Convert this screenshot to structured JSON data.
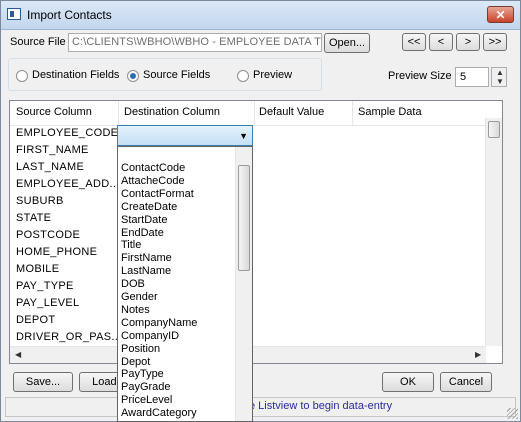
{
  "window": {
    "title": "Import Contacts",
    "close_glyph": "✕"
  },
  "source_file": {
    "label": "Source File",
    "value": "C:\\CLIENTS\\WBHO\\WBHO - EMPLOYEE DATA T",
    "open_label": "Open..."
  },
  "nav_buttons": [
    "<<",
    "<",
    ">",
    ">>"
  ],
  "view_options": {
    "items": [
      {
        "label": "Destination Fields",
        "selected": false
      },
      {
        "label": "Source Fields",
        "selected": true
      },
      {
        "label": "Preview",
        "selected": false
      }
    ]
  },
  "preview_size": {
    "label": "Preview Size",
    "value": "5"
  },
  "listview": {
    "columns": [
      "Source Column",
      "Destination Column",
      "Default Value",
      "Sample Data"
    ],
    "rows": [
      "EMPLOYEE_CODE",
      "FIRST_NAME",
      "LAST_NAME",
      "EMPLOYEE_ADD...",
      "SUBURB",
      "STATE",
      "POSTCODE",
      "HOME_PHONE",
      "MOBILE",
      "PAY_TYPE",
      "PAY_LEVEL",
      "DEPOT",
      "DRIVER_OR_PAS..."
    ]
  },
  "destination_dropdown": {
    "selected_value": "",
    "options": [
      "ContactCode",
      "AttacheCode",
      "ContactFormat",
      "CreateDate",
      "StartDate",
      "EndDate",
      "Title",
      "FirstName",
      "LastName",
      "DOB",
      "Gender",
      "Notes",
      "CompanyName",
      "CompanyID",
      "Position",
      "Depot",
      "PayType",
      "PayGrade",
      "PriceLevel",
      "AwardCategory"
    ]
  },
  "footer": {
    "save_label": "Save...",
    "load_label": "Load...",
    "ok_label": "OK",
    "cancel_label": "Cancel"
  },
  "status": {
    "text": "e Listview to begin data-entry"
  },
  "colors": {
    "accent": "#3c7fb1",
    "status_text": "#2b2b9e",
    "close_button": "#c7432b"
  }
}
